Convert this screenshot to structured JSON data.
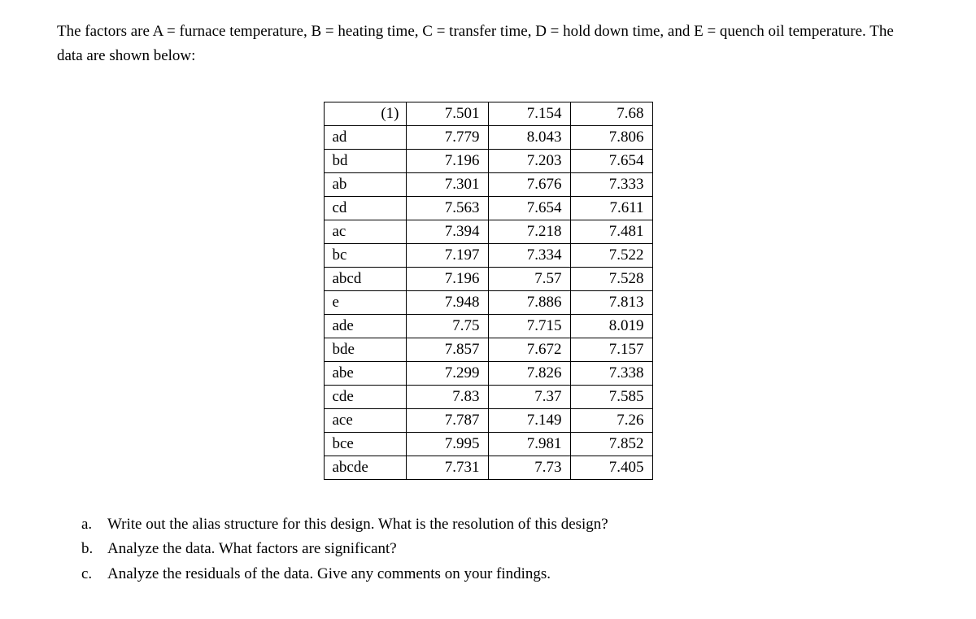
{
  "intro": "The factors are A = furnace temperature, B = heating time, C = transfer time, D = hold down time, and E = quench oil temperature. The data are shown below:",
  "table": {
    "rows": [
      {
        "label": "(1)",
        "c1": "7.501",
        "c2": "7.154",
        "c3": "7.68"
      },
      {
        "label": "ad",
        "c1": "7.779",
        "c2": "8.043",
        "c3": "7.806"
      },
      {
        "label": "bd",
        "c1": "7.196",
        "c2": "7.203",
        "c3": "7.654"
      },
      {
        "label": "ab",
        "c1": "7.301",
        "c2": "7.676",
        "c3": "7.333"
      },
      {
        "label": "cd",
        "c1": "7.563",
        "c2": "7.654",
        "c3": "7.611"
      },
      {
        "label": "ac",
        "c1": "7.394",
        "c2": "7.218",
        "c3": "7.481"
      },
      {
        "label": "bc",
        "c1": "7.197",
        "c2": "7.334",
        "c3": "7.522"
      },
      {
        "label": "abcd",
        "c1": "7.196",
        "c2": "7.57",
        "c3": "7.528"
      },
      {
        "label": "e",
        "c1": "7.948",
        "c2": "7.886",
        "c3": "7.813"
      },
      {
        "label": "ade",
        "c1": "7.75",
        "c2": "7.715",
        "c3": "8.019"
      },
      {
        "label": "bde",
        "c1": "7.857",
        "c2": "7.672",
        "c3": "7.157"
      },
      {
        "label": "abe",
        "c1": "7.299",
        "c2": "7.826",
        "c3": "7.338"
      },
      {
        "label": "cde",
        "c1": "7.83",
        "c2": "7.37",
        "c3": "7.585"
      },
      {
        "label": "ace",
        "c1": "7.787",
        "c2": "7.149",
        "c3": "7.26"
      },
      {
        "label": "bce",
        "c1": "7.995",
        "c2": "7.981",
        "c3": "7.852"
      },
      {
        "label": "abcde",
        "c1": "7.731",
        "c2": "7.73",
        "c3": "7.405"
      }
    ]
  },
  "questions": [
    {
      "letter": "a.",
      "text": "Write out the alias structure for this design. What is the resolution of this design?"
    },
    {
      "letter": "b.",
      "text": "Analyze the data. What factors are significant?"
    },
    {
      "letter": "c.",
      "text": "Analyze the residuals of the data. Give any comments on your findings."
    }
  ]
}
